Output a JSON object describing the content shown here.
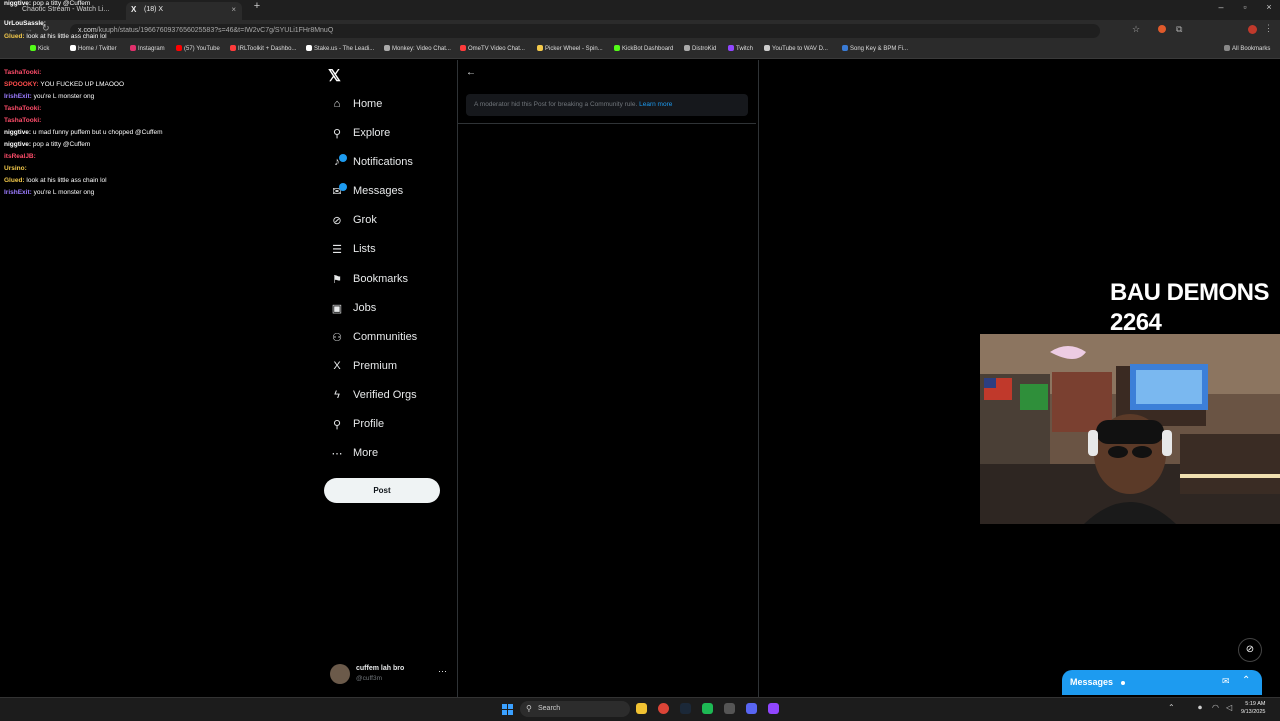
{
  "browser": {
    "tabs": [
      {
        "label": "Chaotic Stream - Watch Li..."
      },
      {
        "label": "(18) X"
      }
    ],
    "url_host": "x.com",
    "url_path": "/kuuph/status/1966760937656025583?s=46&t=IW2vC7g/SYULi1FHr8MnuQ",
    "bookmarks": [
      "Kick",
      "Home / Twitter",
      "Instagram",
      "(57) YouTube",
      "IRLToolkit + Dashbo...",
      "Stake.us - The Leadi...",
      "Monkey: Video Chat...",
      "OmeTV Video Chat...",
      "Picker Wheel - Spin...",
      "KickBot Dashboard",
      "DistroKid",
      "Twitch",
      "YouTube to WAV D...",
      "Song Key & BPM Fi..."
    ],
    "all_bookmarks": "All Bookmarks"
  },
  "chat": [
    {
      "user": "niggtive:",
      "msg": "pop a titty @Cuffem",
      "color": "#ffffff"
    },
    {
      "user": "UrLouSassle:",
      "msg": "",
      "color": "#ffffff"
    },
    {
      "user": "Glued:",
      "msg": "look at his little ass chain lol",
      "color": "#f3c94b"
    },
    {
      "user": "",
      "msg": "",
      "color": "#ff4d6a"
    },
    {
      "user": "TashaTooki:",
      "msg": "",
      "color": "#ff4d6a"
    },
    {
      "user": "SPOOOKY:",
      "msg": "YOU FUCKED UP LMAOOO",
      "color": "#ff4d4d"
    },
    {
      "user": "IrishExit:",
      "msg": "you're L monster ong",
      "color": "#9b7bff"
    },
    {
      "user": "TashaTooki:",
      "msg": "",
      "color": "#ff4d6a"
    },
    {
      "user": "TashaTooki:",
      "msg": "",
      "color": "#ff4d6a"
    },
    {
      "user": "niggtive:",
      "msg": "u mad funny puffem but u chopped @Cuffem",
      "color": "#ffffff"
    },
    {
      "user": "niggtive:",
      "msg": "pop a titty @Cuffem",
      "color": "#ffffff"
    },
    {
      "user": "itsRealJB:",
      "msg": "",
      "color": "#ff4d6a"
    },
    {
      "user": "Ursino:",
      "msg": "",
      "color": "#f3c94b"
    },
    {
      "user": "Glued:",
      "msg": "look at his little ass chain lol",
      "color": "#f3c94b"
    },
    {
      "user": "IrishExit:",
      "msg": "you're L monster ong",
      "color": "#9b7bff"
    }
  ],
  "sidebar": {
    "items": [
      {
        "label": "Home",
        "icon": "home-icon",
        "glyph": "⌂"
      },
      {
        "label": "Explore",
        "icon": "search-icon",
        "glyph": "⚲"
      },
      {
        "label": "Notifications",
        "icon": "bell-icon",
        "glyph": "♪"
      },
      {
        "label": "Messages",
        "icon": "envelope-icon",
        "glyph": "✉"
      },
      {
        "label": "Grok",
        "icon": "grok-icon",
        "glyph": "⊘"
      },
      {
        "label": "Lists",
        "icon": "list-icon",
        "glyph": "☰"
      },
      {
        "label": "Bookmarks",
        "icon": "bookmark-icon",
        "glyph": "⚑"
      },
      {
        "label": "Jobs",
        "icon": "briefcase-icon",
        "glyph": "▣"
      },
      {
        "label": "Communities",
        "icon": "people-icon",
        "glyph": "⚇"
      },
      {
        "label": "Premium",
        "icon": "x-logo-icon",
        "glyph": "X"
      },
      {
        "label": "Verified Orgs",
        "icon": "lightning-icon",
        "glyph": "ϟ"
      },
      {
        "label": "Profile",
        "icon": "person-icon",
        "glyph": "⚲"
      },
      {
        "label": "More",
        "icon": "more-circle-icon",
        "glyph": "⋯"
      }
    ],
    "post_label": "Post",
    "profile_name": "cuffem lah bro",
    "profile_handle": "@cuff3m"
  },
  "main": {
    "notice_text": "A moderator hid this Post for breaking a Community rule.",
    "learn_more": "Learn more"
  },
  "overlay": {
    "title_line1": "BAU DEMONS",
    "title_line2": "2264"
  },
  "messages_drawer": {
    "label": "Messages"
  },
  "taskbar": {
    "search_label": "Search",
    "time": "5:19 AM",
    "date": "9/13/2025"
  },
  "colors": {
    "accent": "#1d9bf0",
    "bg": "#000000",
    "text": "#e7e9ea",
    "muted": "#71767b"
  }
}
